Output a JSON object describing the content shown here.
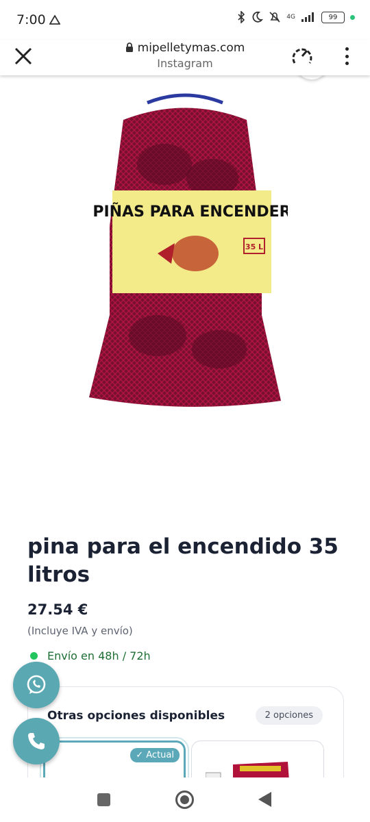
{
  "status_bar": {
    "time": "7:00",
    "network": "4G",
    "battery": "99"
  },
  "browser": {
    "url": "mipelletymas.com",
    "source": "Instagram"
  },
  "product": {
    "image_label": {
      "headline": "PIÑAS PARA ENCENDER",
      "size": "35 L"
    },
    "title": "pina para el encendido 35 litros",
    "price": "27.54 €",
    "tax_note": "(Incluye IVA y envío)",
    "shipping": "Envío en 48h / 72h"
  },
  "options": {
    "title": "Otras opciones disponibles",
    "count": "2 opciones",
    "current_badge": "✓ Actual"
  },
  "colors": {
    "accent": "#5aa8b2",
    "shipping_green": "#22c55e",
    "net_red": "#b0123a"
  }
}
